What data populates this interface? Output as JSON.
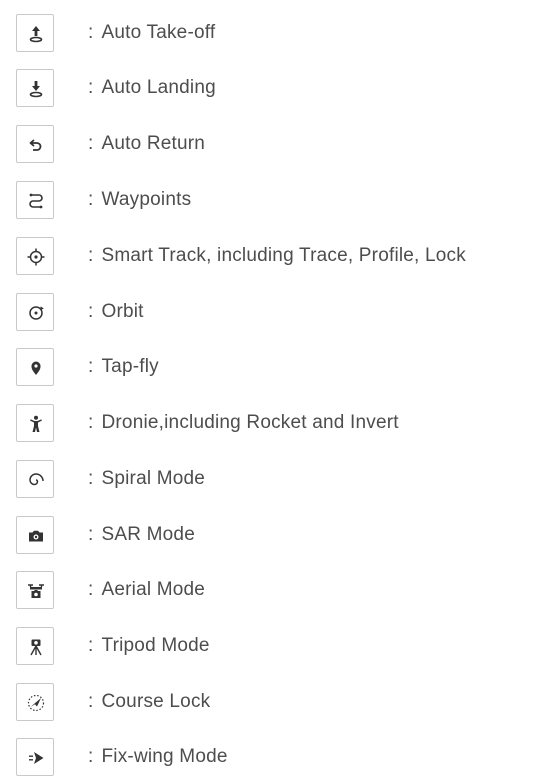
{
  "legend": {
    "separator": ":",
    "items": [
      {
        "icon": "takeoff-icon",
        "label": "Auto Take-off"
      },
      {
        "icon": "landing-icon",
        "label": "Auto Landing"
      },
      {
        "icon": "return-icon",
        "label": "Auto Return"
      },
      {
        "icon": "waypoints-icon",
        "label": "Waypoints"
      },
      {
        "icon": "crosshair-icon",
        "label": "Smart Track, including Trace, Profile, Lock"
      },
      {
        "icon": "orbit-icon",
        "label": "Orbit"
      },
      {
        "icon": "map-pin-icon",
        "label": "Tap-fly"
      },
      {
        "icon": "person-icon",
        "label": "Dronie,including Rocket and Invert"
      },
      {
        "icon": "spiral-icon",
        "label": "Spiral Mode"
      },
      {
        "icon": "camera-icon",
        "label": "SAR Mode"
      },
      {
        "icon": "drone-camera-icon",
        "label": "Aerial Mode"
      },
      {
        "icon": "tripod-icon",
        "label": "Tripod Mode"
      },
      {
        "icon": "compass-icon",
        "label": "Course Lock"
      },
      {
        "icon": "plane-icon",
        "label": "Fix-wing Mode"
      }
    ]
  }
}
